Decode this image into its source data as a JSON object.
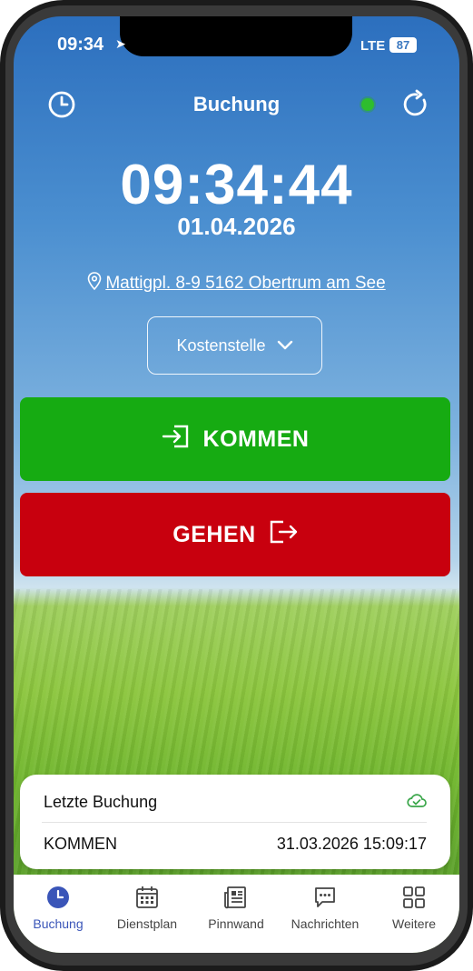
{
  "status_bar": {
    "time": "09:34",
    "network": "LTE",
    "battery": "87"
  },
  "header": {
    "title": "Buchung",
    "history_icon": "clock-icon",
    "refresh_icon": "refresh-icon",
    "online_color": "#2ebd2e"
  },
  "clock": {
    "time": "09:34:44",
    "date": "01.04.2026"
  },
  "location": {
    "address": "Mattigpl. 8-9 5162 Obertrum am See",
    "icon": "location-pin-icon"
  },
  "cost_center": {
    "label": "Kostenstelle",
    "icon": "chevron-down-icon"
  },
  "actions": {
    "kommen": {
      "label": "KOMMEN",
      "color": "#16ab12",
      "icon": "login-icon"
    },
    "gehen": {
      "label": "GEHEN",
      "color": "#c8000e",
      "icon": "logout-icon"
    }
  },
  "last_booking": {
    "title": "Letzte Buchung",
    "type": "KOMMEN",
    "timestamp": "31.03.2026 15:09:17",
    "sync_icon": "cloud-check-icon",
    "sync_color": "#3aa64a"
  },
  "tabs": [
    {
      "label": "Buchung",
      "icon": "clock-icon",
      "active": true
    },
    {
      "label": "Dienstplan",
      "icon": "calendar-icon",
      "active": false
    },
    {
      "label": "Pinnwand",
      "icon": "newspaper-icon",
      "active": false
    },
    {
      "label": "Nachrichten",
      "icon": "chat-icon",
      "active": false
    },
    {
      "label": "Weitere",
      "icon": "grid-icon",
      "active": false
    }
  ],
  "accent_color": "#3a55b8"
}
